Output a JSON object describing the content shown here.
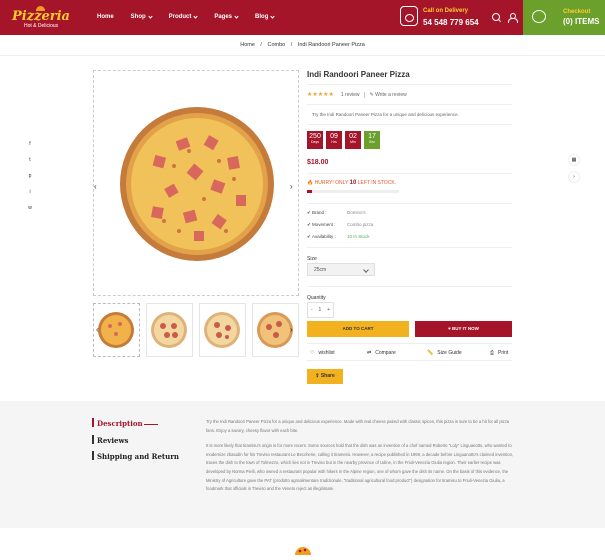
{
  "header": {
    "logo_text": "Pizzeria",
    "logo_sub": "Hot & Delicious",
    "nav": [
      {
        "label": "Home",
        "dropdown": false
      },
      {
        "label": "Shop",
        "dropdown": true
      },
      {
        "label": "Product",
        "dropdown": true
      },
      {
        "label": "Pages",
        "dropdown": true
      },
      {
        "label": "Blog",
        "dropdown": true
      }
    ],
    "delivery_label": "Call on Delivery",
    "delivery_phone": "54 548 779 654",
    "checkout_label": "Checkout",
    "items_label": "(0) ITEMS",
    "colors": {
      "brand": "#a5152a",
      "accent": "#ffcc2f",
      "cart": "#6aa02b"
    }
  },
  "breadcrumb": [
    "Home",
    "/",
    "Combo",
    "/",
    "Indi Randoori Paneer Pizza"
  ],
  "social": [
    "f",
    "t",
    "p",
    "i",
    "w"
  ],
  "product": {
    "title": "Indi Randoori Paneer Pizza",
    "stars": "★★★★★",
    "review_count": "1 review",
    "write_review": "Write a review",
    "description": "Try the Indi Randoori Paneer Pizza for a unique and delicious experience.",
    "countdown": [
      {
        "value": "250",
        "label": "Days",
        "color": "#a5152a"
      },
      {
        "value": "09",
        "label": "Hrs",
        "color": "#a5152a"
      },
      {
        "value": "02",
        "label": "Min",
        "color": "#a5152a"
      },
      {
        "value": "17",
        "label": "Sec",
        "color": "#6aa02b"
      }
    ],
    "price": "$18.00",
    "hurry_prefix": "HURRY! ONLY",
    "hurry_count": "10",
    "hurry_suffix": "LEFT IN STOCK.",
    "stock_fraction": 0.05,
    "meta": [
      {
        "key": "Brand :",
        "value": "Domino's",
        "green": false
      },
      {
        "key": "Movement :",
        "value": "Combo pizza",
        "green": false
      },
      {
        "key": "Availability :",
        "value": "10 In Stock",
        "green": true
      }
    ],
    "size_label": "Size",
    "size_value": "25cm",
    "quantity_label": "Quantity",
    "qty_minus": "-",
    "qty_value": "1",
    "qty_plus": "+",
    "add_to_cart": "ADD TO CART",
    "buy_now": "BUY IT NOW",
    "actions": [
      "wishlist",
      "Compare",
      "Size Guide",
      "Print"
    ],
    "share": "Share"
  },
  "tabs": [
    "Description",
    "Reviews",
    "Shipping and Return"
  ],
  "long_description": [
    "Try the Indi Randoori Paneer Pizza for a unique and delicious experience. Made with real cheese paired with classic spices, this pizza is sure to be a hit for all pizza fans. Enjoy a savory, cheesy flavor with each bite.",
    "It is more likely that tiramisu's origin is for more recent. Some sources hold that the dish was an invention of a chef named Roberto \"Loly\" Linguanotto, who wanted to modernize zbatudin for his Treviso restaurant Le Beccherie, calling it tiramesù. However, a recipe published in 1959, a decade before Linguanotto's claimed invention, traces the dish to the town of Tolmezzo, which lies not in Treviso but in the nearby province of Udine, in the Friuli-Venezia Giulia region. Their earlier recipe was developed by Norma Pielli, who owned a restaurant popular with hikers in the Alpine region, one of whom gave the dish its name. On the basis of this evidence, the Ministry of Agriculture gave the PAT (prodotto agroalimentare tradizionale, \"traditional agricultural food product\") designation for tiramisu to Friuli-Venezia Giulia, a foodmark that officials in Treviso and the Veneto reject as illegitimate."
  ]
}
